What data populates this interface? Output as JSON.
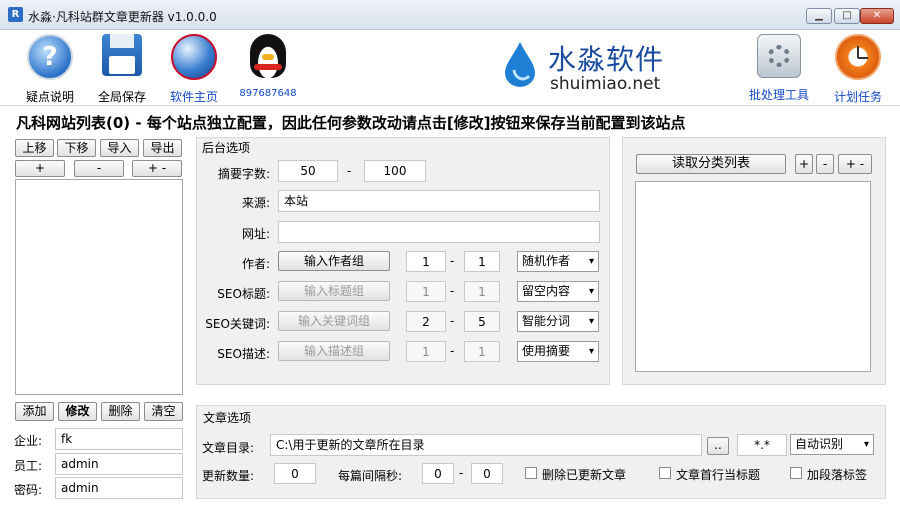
{
  "window": {
    "title": "水淼·凡科站群文章更新器 v1.0.0.0",
    "app_icon_letter": "R"
  },
  "toolbar": {
    "items": [
      {
        "id": "help",
        "label": "疑点说明",
        "icon": "help-icon"
      },
      {
        "id": "save",
        "label": "全局保存",
        "icon": "floppy-save-icon"
      },
      {
        "id": "home",
        "label": "软件主页",
        "icon": "globe-icon"
      },
      {
        "id": "qq",
        "label": "897687648",
        "icon": "qq-penguin-icon"
      },
      {
        "id": "batch",
        "label": "批处理工具",
        "icon": "batch-tool-icon"
      },
      {
        "id": "schedule",
        "label": "计划任务",
        "icon": "clock-icon"
      }
    ],
    "logo_cn": "水淼软件",
    "logo_en": "shuimiao.net"
  },
  "heading": "凡科网站列表(0) - 每个站点独立配置，因此任何参数改动请点击[修改]按钮来保存当前配置到该站点",
  "left": {
    "buttons_row1": [
      "上移",
      "下移",
      "导入",
      "导出"
    ],
    "buttons_row2": [
      "+",
      "-",
      "+ -"
    ],
    "buttons_bottom": [
      "添加",
      "修改",
      "删除",
      "清空"
    ],
    "fields": [
      {
        "label": "企业:",
        "value": "fk"
      },
      {
        "label": "员工:",
        "value": "admin"
      },
      {
        "label": "密码:",
        "value": "admin"
      }
    ]
  },
  "backend": {
    "title": "后台选项",
    "summary": {
      "label": "摘要字数:",
      "min": "50",
      "sep": "-",
      "max": "100"
    },
    "source": {
      "label": "来源:",
      "value": "本站"
    },
    "url": {
      "label": "网址:",
      "value": ""
    },
    "rows": [
      {
        "label": "作者:",
        "button": "输入作者组",
        "min": "1",
        "max": "1",
        "select": "随机作者",
        "disabled": false
      },
      {
        "label": "SEO标题:",
        "button": "输入标题组",
        "min": "1",
        "max": "1",
        "select": "留空内容",
        "disabled": true
      },
      {
        "label": "SEO关键词:",
        "button": "输入关键词组",
        "min": "2",
        "max": "5",
        "select": "智能分词",
        "disabled": true
      },
      {
        "label": "SEO描述:",
        "button": "输入描述组",
        "min": "1",
        "max": "1",
        "select": "使用摘要",
        "disabled": true
      }
    ],
    "dash": "-"
  },
  "category": {
    "read_button": "读取分类列表",
    "small_buttons": [
      "+",
      "-",
      "+ -"
    ]
  },
  "article": {
    "title": "文章选项",
    "dir_label": "文章目录:",
    "dir_value": "C:\\用于更新的文章所在目录",
    "browse": "..",
    "ext_value": "*.*",
    "encoding_select": "自动识别",
    "count_label": "更新数量:",
    "count_value": "0",
    "interval_label": "每篇间隔秒:",
    "interval_min": "0",
    "interval_sep": "-",
    "interval_max": "0",
    "checkboxes": [
      "删除已更新文章",
      "文章首行当标题",
      "加段落标签"
    ]
  }
}
